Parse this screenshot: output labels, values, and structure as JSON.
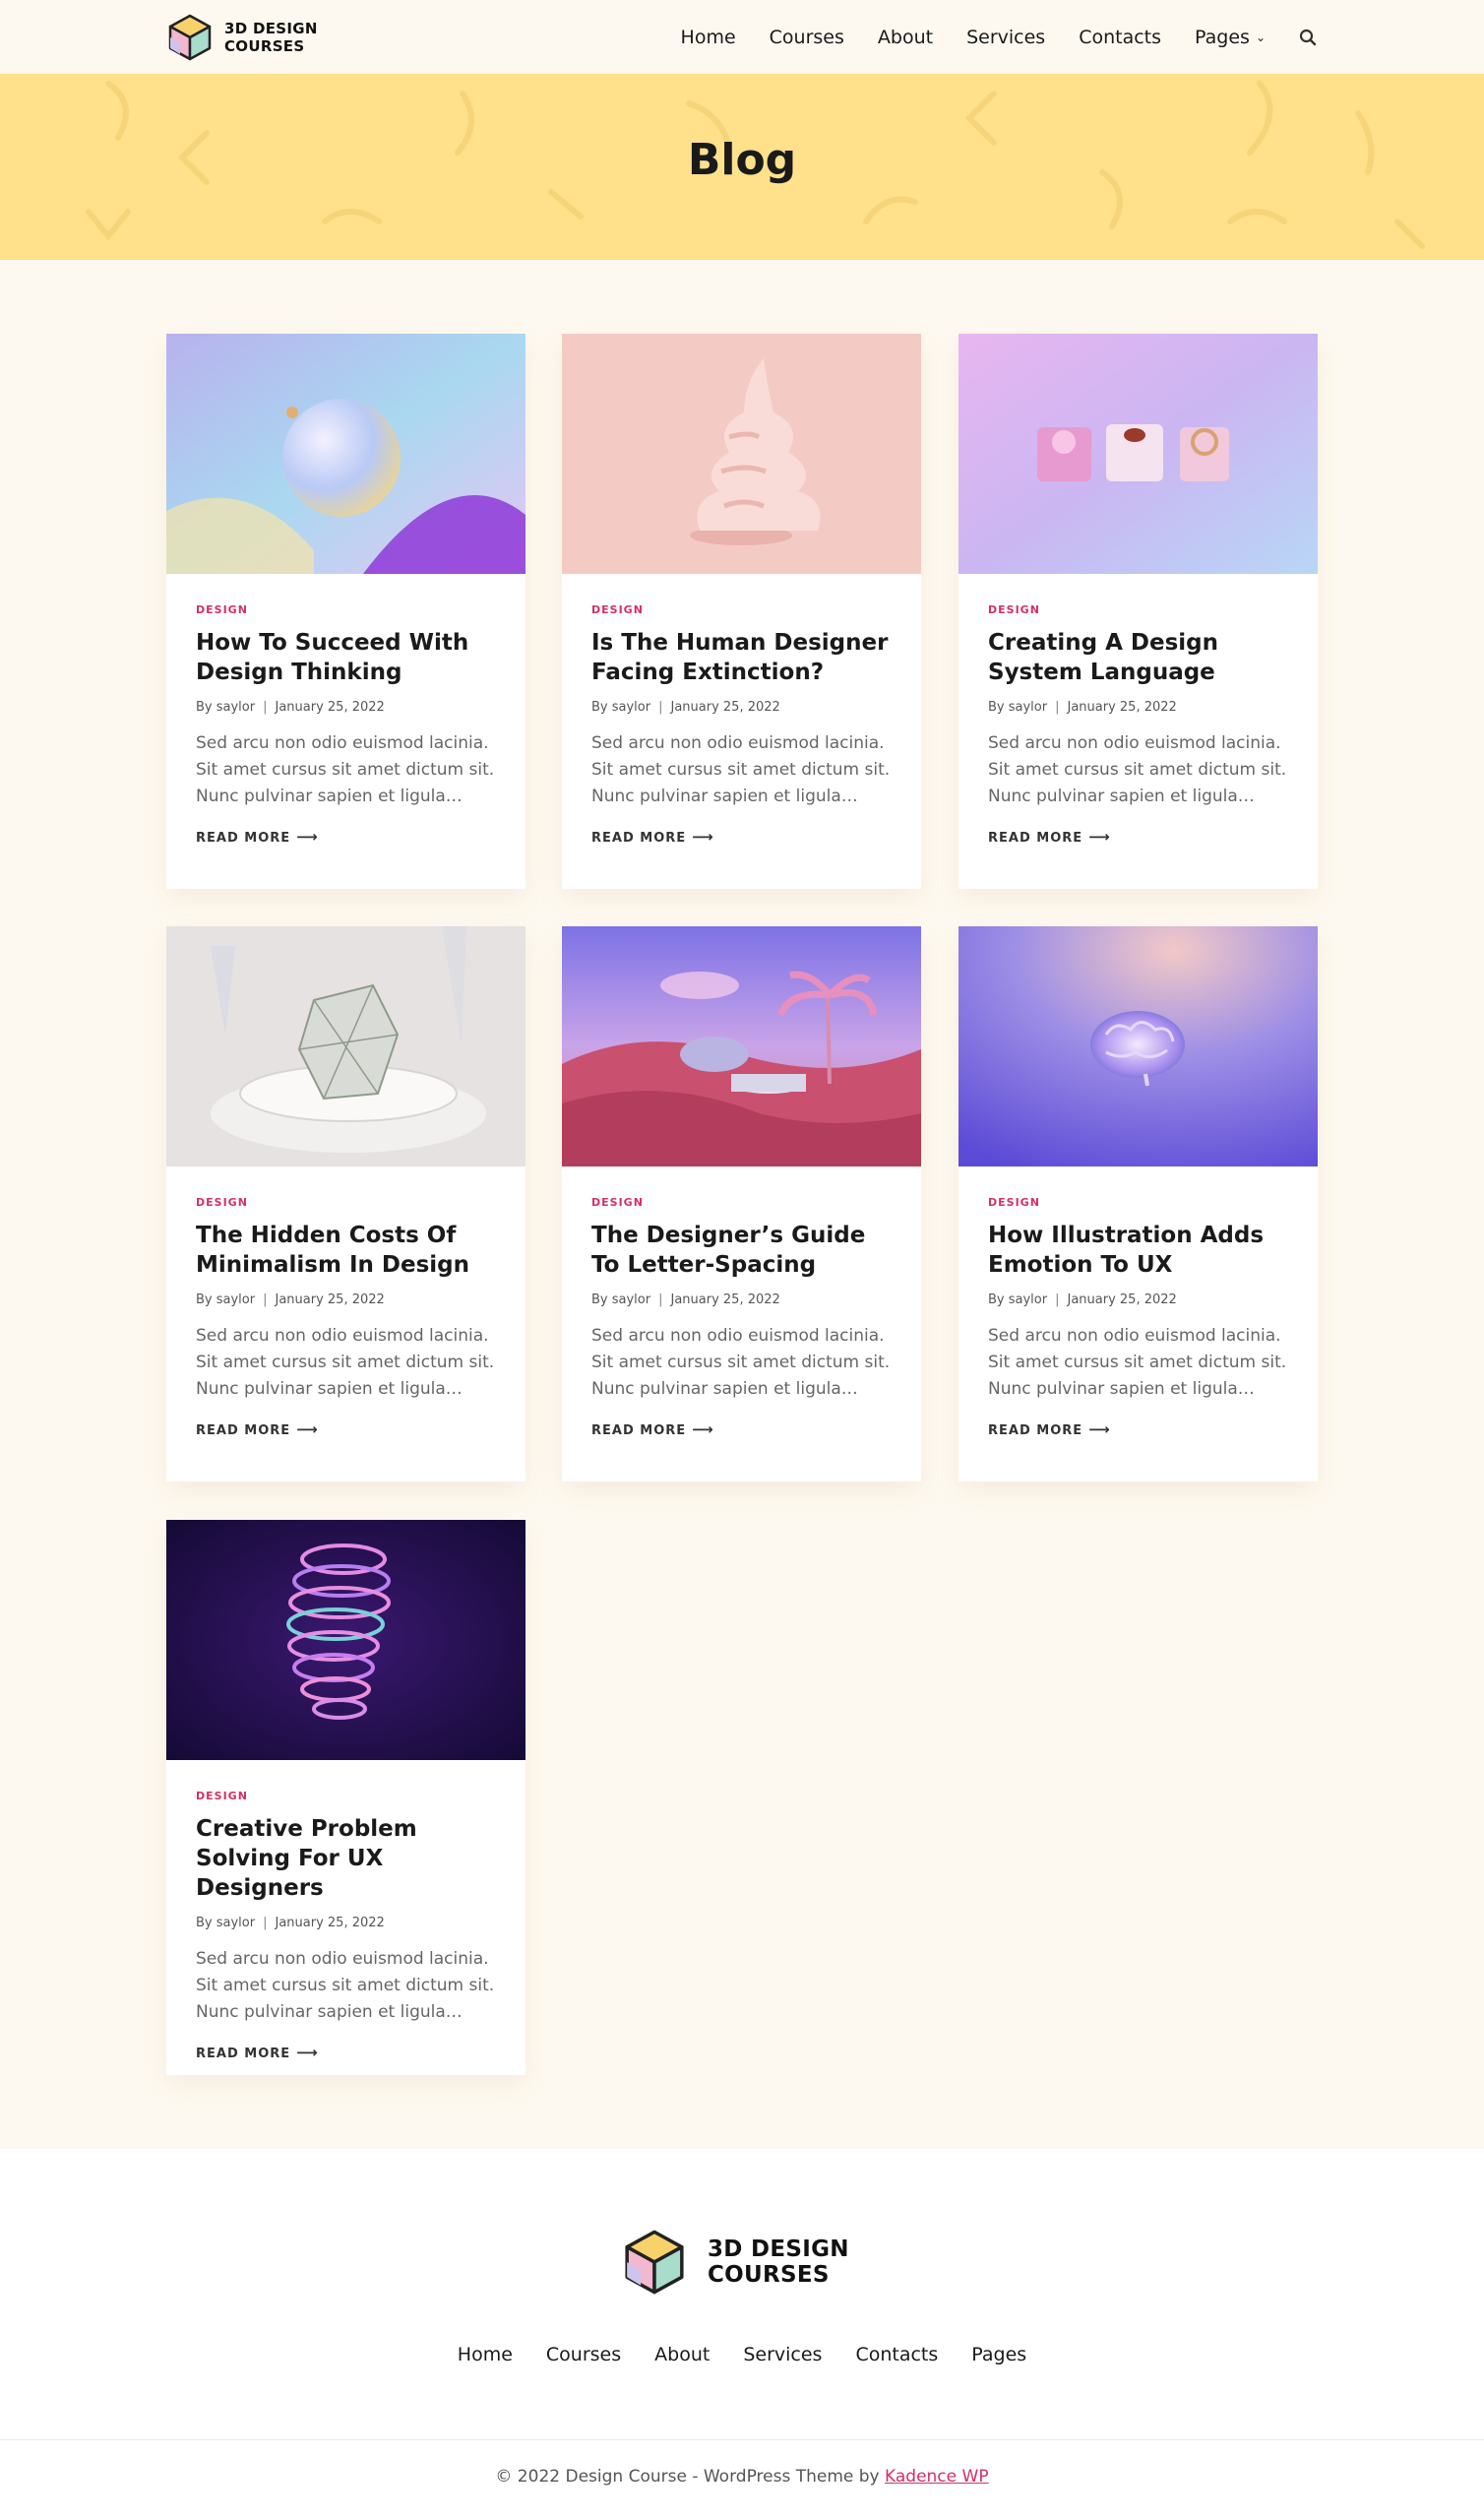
{
  "site": {
    "logo_line1": "3D DESIGN",
    "logo_line2": "COURSES"
  },
  "nav": {
    "items": [
      "Home",
      "Courses",
      "About",
      "Services",
      "Contacts",
      "Pages"
    ],
    "search_icon": "search-icon",
    "chevron_icon": "chevron-down-icon"
  },
  "hero": {
    "title": "Blog"
  },
  "posts": [
    {
      "category": "DESIGN",
      "title": "How To Succeed With Design Thinking",
      "author": "By saylor",
      "date": "January 25, 2022",
      "excerpt": "Sed arcu non odio euismod lacinia. Sit amet cursus sit amet dictum sit. Nunc pulvinar sapien et ligula…",
      "read_more": "READ MORE"
    },
    {
      "category": "DESIGN",
      "title": "Is The Human Designer Facing Extinction?",
      "author": "By saylor",
      "date": "January 25, 2022",
      "excerpt": "Sed arcu non odio euismod lacinia. Sit amet cursus sit amet dictum sit. Nunc pulvinar sapien et ligula…",
      "read_more": "READ MORE"
    },
    {
      "category": "DESIGN",
      "title": "Creating A Design System Language",
      "author": "By saylor",
      "date": "January 25, 2022",
      "excerpt": "Sed arcu non odio euismod lacinia. Sit amet cursus sit amet dictum sit. Nunc pulvinar sapien et ligula…",
      "read_more": "READ MORE"
    },
    {
      "category": "DESIGN",
      "title": "The Hidden Costs Of Minimalism In Design",
      "author": "By saylor",
      "date": "January 25, 2022",
      "excerpt": "Sed arcu non odio euismod lacinia. Sit amet cursus sit amet dictum sit. Nunc pulvinar sapien et ligula…",
      "read_more": "READ MORE"
    },
    {
      "category": "DESIGN",
      "title": "The Designer’s Guide To Letter-Spacing",
      "author": "By saylor",
      "date": "January 25, 2022",
      "excerpt": "Sed arcu non odio euismod lacinia. Sit amet cursus sit amet dictum sit. Nunc pulvinar sapien et ligula…",
      "read_more": "READ MORE"
    },
    {
      "category": "DESIGN",
      "title": "How Illustration Adds Emotion To UX",
      "author": "By saylor",
      "date": "January 25, 2022",
      "excerpt": "Sed arcu non odio euismod lacinia. Sit amet cursus sit amet dictum sit. Nunc pulvinar sapien et ligula…",
      "read_more": "READ MORE"
    },
    {
      "category": "DESIGN",
      "title": "Creative Problem Solving For UX Designers",
      "author": "By saylor",
      "date": "January 25, 2022",
      "excerpt": "Sed arcu non odio euismod lacinia. Sit amet cursus sit amet dictum sit. Nunc pulvinar sapien et ligula…",
      "read_more": "READ MORE"
    }
  ],
  "footer": {
    "nav": [
      "Home",
      "Courses",
      "About",
      "Services",
      "Contacts",
      "Pages"
    ],
    "copyright_prefix": "© 2022 Design Course - WordPress Theme by ",
    "copyright_link": "Kadence WP"
  },
  "colors": {
    "accent": "#d33163",
    "hero_bg": "#fee18a",
    "page_bg": "#fef9f0"
  }
}
